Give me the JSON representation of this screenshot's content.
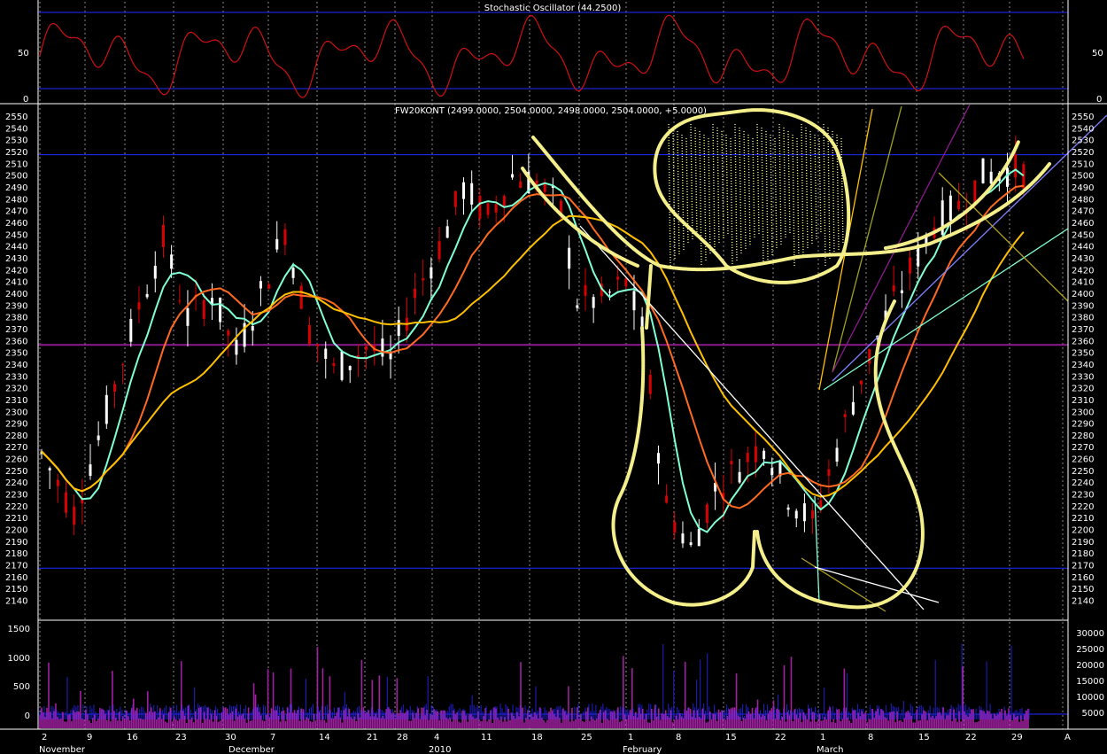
{
  "colors": {
    "background": "#000000",
    "panel_border": "#ffffff",
    "grid_dotted": "#8a8a8a",
    "text": "#ffffff",
    "blue_line": "#1e2cff",
    "purple_line": "#8b1a8b",
    "stoch_line": "#d01010",
    "candle_white": "#ffffff",
    "candle_red": "#d80000",
    "ma_cyan": "#7fffd4",
    "ma_orange": "#ff6a20",
    "ma_gold": "#ffc000",
    "drawing_yellow": "#f4ef8a",
    "volume_purple": "#a020a0",
    "volume_blue": "#2020d0"
  },
  "stochastic_panel": {
    "title": "Stochastic Oscillator (44.2500)",
    "left_ticks": [
      "50",
      "0"
    ],
    "right_ticks": [
      "50",
      "0"
    ]
  },
  "price_panel": {
    "title": "FW20KONT (2499.0000, 2504.0000, 2498.0000, 2504.0000, +5.0000)",
    "ticks": [
      "2550",
      "2540",
      "2530",
      "2520",
      "2510",
      "2500",
      "2490",
      "2480",
      "2470",
      "2460",
      "2450",
      "2440",
      "2430",
      "2420",
      "2410",
      "2400",
      "2390",
      "2380",
      "2370",
      "2360",
      "2350",
      "2340",
      "2330",
      "2320",
      "2310",
      "2300",
      "2290",
      "2280",
      "2270",
      "2260",
      "2250",
      "2240",
      "2230",
      "2220",
      "2210",
      "2200",
      "2190",
      "2180",
      "2170",
      "2160",
      "2150",
      "2140"
    ]
  },
  "volume_panel": {
    "left_ticks": [
      "1500",
      "1000",
      "500",
      "0"
    ],
    "right_ticks": [
      "30000",
      "25000",
      "20000",
      "15000",
      "10000",
      "5000"
    ]
  },
  "x_axis": {
    "day_labels": [
      "2",
      "9",
      "16",
      "23",
      "30",
      "7",
      "14",
      "21",
      "28",
      "4",
      "11",
      "18",
      "25",
      "1",
      "8",
      "15",
      "22",
      "1",
      "8",
      "15",
      "22",
      "29",
      "A"
    ],
    "month_labels": [
      "November",
      "December",
      "2010",
      "February",
      "March"
    ]
  },
  "chart_data": {
    "type": "candlestick",
    "instrument": "FW20KONT",
    "last_bar": {
      "open": 2499,
      "high": 2504,
      "low": 2498,
      "close": 2504,
      "change": 5
    },
    "ylim": [
      2130,
      2555
    ],
    "horizontal_levels": [
      2518,
      2357,
      2168
    ],
    "overlay_series": [
      "cyan moving average",
      "orange moving average",
      "gold moving average"
    ],
    "stochastic": {
      "value": 44.25,
      "ylim": [
        0,
        100
      ],
      "levels": [
        90,
        10
      ]
    },
    "x_categories": [
      "2",
      "9",
      "16",
      "23",
      "30",
      "7",
      "14",
      "21",
      "28",
      "4",
      "11",
      "18",
      "25",
      "1",
      "8",
      "15",
      "22",
      "1",
      "8",
      "15",
      "22",
      "29"
    ],
    "close_path": [
      [
        0,
        2265
      ],
      [
        4,
        2215
      ],
      [
        8,
        2300
      ],
      [
        12,
        2390
      ],
      [
        15,
        2445
      ],
      [
        18,
        2380
      ],
      [
        21,
        2400
      ],
      [
        24,
        2350
      ],
      [
        27,
        2400
      ],
      [
        30,
        2455
      ],
      [
        33,
        2370
      ],
      [
        36,
        2335
      ],
      [
        40,
        2355
      ],
      [
        43,
        2345
      ],
      [
        46,
        2400
      ],
      [
        49,
        2440
      ],
      [
        52,
        2490
      ],
      [
        55,
        2465
      ],
      [
        58,
        2500
      ],
      [
        61,
        2495
      ],
      [
        64,
        2470
      ],
      [
        66,
        2395
      ],
      [
        69,
        2395
      ],
      [
        72,
        2410
      ],
      [
        74,
        2370
      ],
      [
        77,
        2220
      ],
      [
        80,
        2185
      ],
      [
        83,
        2235
      ],
      [
        86,
        2255
      ],
      [
        89,
        2275
      ],
      [
        92,
        2230
      ],
      [
        95,
        2205
      ],
      [
        98,
        2270
      ],
      [
        101,
        2330
      ],
      [
        104,
        2380
      ],
      [
        107,
        2420
      ],
      [
        110,
        2460
      ],
      [
        113,
        2475
      ],
      [
        116,
        2500
      ],
      [
        119,
        2505
      ],
      [
        121,
        2504
      ]
    ]
  }
}
